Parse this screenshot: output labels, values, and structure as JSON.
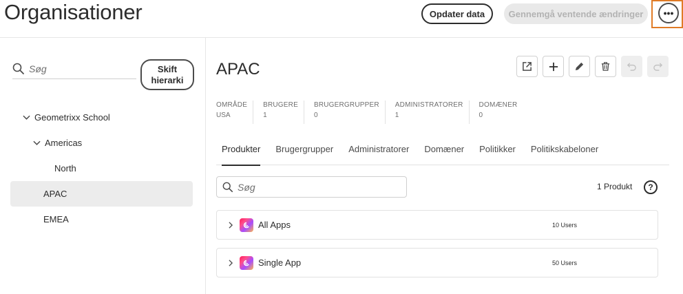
{
  "header": {
    "title": "Organisationer",
    "refresh_label": "Opdater data",
    "review_label": "Gennemgå ventende ændringer",
    "more_label": "•••"
  },
  "left": {
    "search_placeholder": "Søg",
    "toggle_label": "Skift\nhierarki",
    "tree": [
      {
        "label": "Geometrixx School",
        "expanded": true,
        "level": 0
      },
      {
        "label": "Americas",
        "expanded": true,
        "level": 1
      },
      {
        "label": "North",
        "level": 2
      },
      {
        "label": "APAC",
        "level": 0,
        "selected": true
      },
      {
        "label": "EMEA",
        "level": 0
      }
    ]
  },
  "org": {
    "title": "APAC",
    "stats": [
      {
        "key": "OMRÅDE",
        "value": "USA"
      },
      {
        "key": "BRUGERE",
        "value": "1"
      },
      {
        "key": "BRUGERGRUPPER",
        "value": "0"
      },
      {
        "key": "ADMINISTRATORER",
        "value": "1"
      },
      {
        "key": "DOMÆNER",
        "value": "0"
      }
    ],
    "toolbar_icons": [
      "external-link-icon",
      "plus-icon",
      "pencil-icon",
      "trash-icon",
      "undo-icon",
      "redo-icon"
    ]
  },
  "tabs": [
    "Produkter",
    "Brugergrupper",
    "Administratorer",
    "Domæner",
    "Politikker",
    "Politikskabeloner"
  ],
  "products": {
    "search_placeholder": "Søg",
    "count_label": "1 Produkt",
    "help_label": "?",
    "items": [
      {
        "name": "All Apps",
        "users": "10 Users"
      },
      {
        "name": "Single App",
        "users": "50 Users"
      }
    ]
  },
  "colors": {
    "highlight": "#e07b26",
    "selected_bg": "#ececec",
    "disabled_bg": "#e9e9e9"
  }
}
